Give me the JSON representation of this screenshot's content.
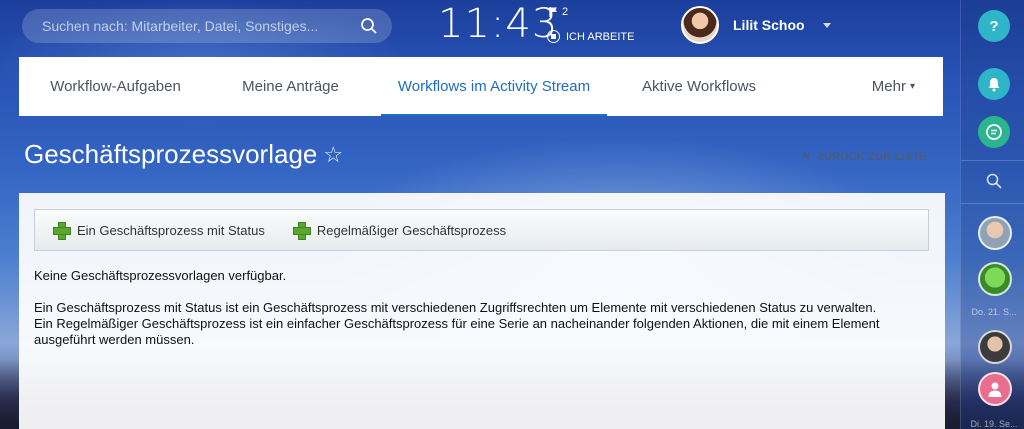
{
  "search": {
    "placeholder": "Suchen nach: Mitarbeiter, Datei, Sonstiges..."
  },
  "clock": {
    "time": "11:43",
    "flag_count": "2",
    "status": "ICH ARBEITE"
  },
  "user": {
    "name": "Lilit Schoo"
  },
  "tabs": [
    {
      "label": "Workflow-Aufgaben"
    },
    {
      "label": "Meine Anträge"
    },
    {
      "label": "Workflows im Activity Stream",
      "active": true
    },
    {
      "label": "Aktive Workflows"
    },
    {
      "label": "Mehr"
    }
  ],
  "page": {
    "title": "Geschäftsprozessvorlage",
    "back_label": "ZURÜCK ZUR LISTE"
  },
  "toolbar": {
    "buttons": [
      {
        "label": "Ein Geschäftsprozess mit Status"
      },
      {
        "label": "Regelmäßiger Geschäftsprozess"
      }
    ]
  },
  "content": {
    "empty_text": "Keine Geschäftsprozessvorlagen verfügbar.",
    "desc_status": "Ein Geschäftsprozess mit Status ist ein Geschäftsprozess mit verschiedenen Zugriffsrechten um Elemente mit verschiedenen Status zu verwalten.",
    "desc_regular": "Ein Regelmäßiger Geschäftsprozess ist ein einfacher Geschäftsprozess für eine Serie an nacheinander folgenden Aktionen, die mit einem Element ausgeführt werden müssen."
  },
  "rail": {
    "help_label": "?",
    "date_1": "Do. 21. S...",
    "date_2": "Di. 19. Se..."
  },
  "colors": {
    "accent": "#1f6ec1",
    "help": "#2fb5c8",
    "bell": "#2fb5c8",
    "chat": "#2bb58e",
    "plus": "#58a82e",
    "avatar_pink": "#e86d8e"
  }
}
